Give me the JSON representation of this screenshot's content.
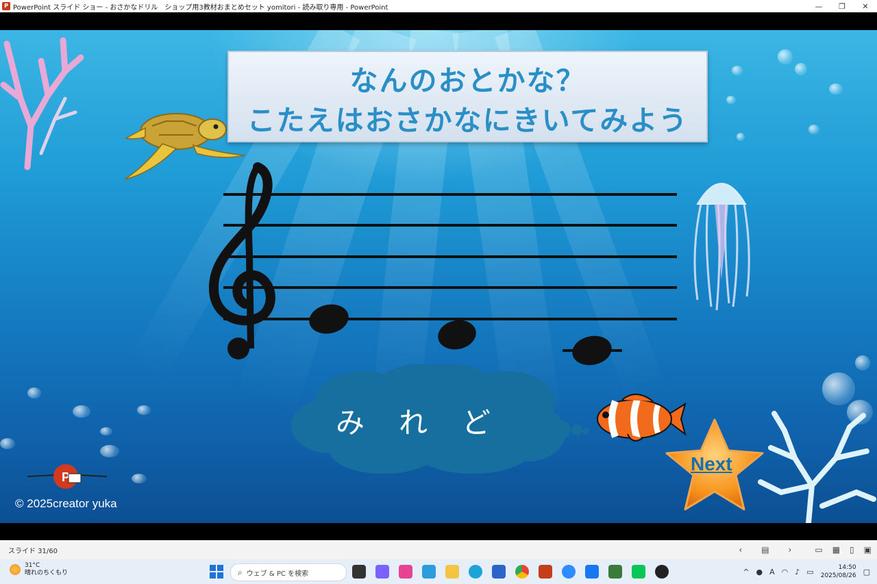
{
  "window": {
    "title": "PowerPoint スライド ショー  -  おさかなドリル　ショップ用3教材おまとめセット yomitori  -  読み取り専用 - PowerPoint",
    "app_icon": "powerpoint-icon",
    "buttons": [
      "minimize-icon",
      "restore-icon",
      "close-icon"
    ]
  },
  "slide": {
    "title_line1": "なんのおとかな？",
    "title_line2": "こたえはおさかなにきいてみよう",
    "answer": "み　れ　ど",
    "next_label": "Next",
    "copyright": "© 2025creator yuka",
    "notes": [
      "E",
      "D",
      "C"
    ]
  },
  "statusbar": {
    "slide_counter": "スライド 31/60",
    "controls": [
      "prev-slide-icon",
      "slide-menu-icon",
      "next-slide-icon",
      "normal-view-icon",
      "slide-sorter-icon",
      "reading-view-icon",
      "slideshow-icon"
    ]
  },
  "taskbar": {
    "weather_temp": "31°C",
    "weather_desc": "晴れのちくもり",
    "search_placeholder": "ウェブ & PC を検索",
    "time": "14:50",
    "date": "2025/08/26",
    "ime": "A",
    "colors": {
      "accent": "#1d74d8",
      "powerpoint": "#c43e1c",
      "line_green": "#06c755"
    }
  }
}
